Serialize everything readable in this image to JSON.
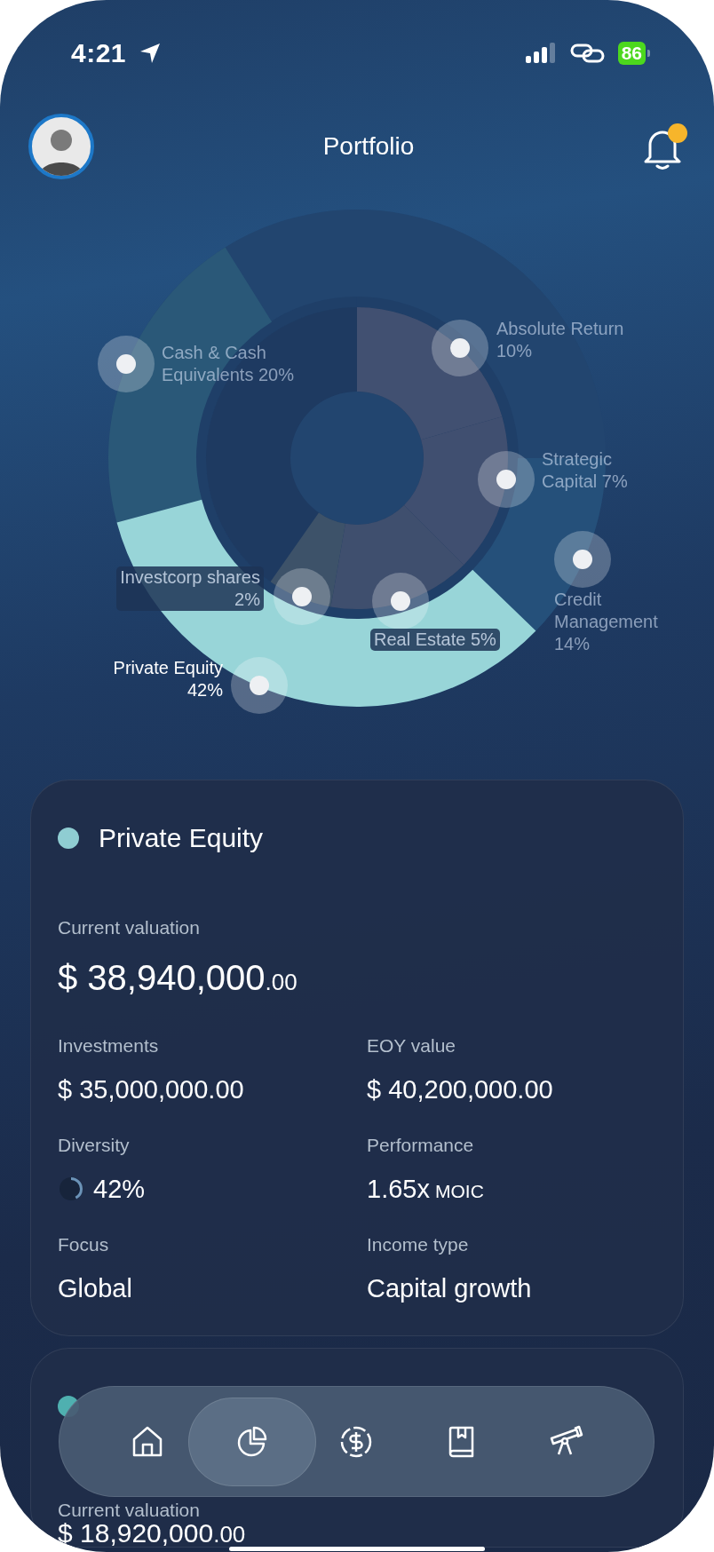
{
  "status_bar": {
    "time": "4:21",
    "battery": "86"
  },
  "header": {
    "title": "Portfolio",
    "notification_badge": true
  },
  "allocation": {
    "segments": [
      {
        "label": "Absolute Return\n10%",
        "kind": "inner",
        "selected": false
      },
      {
        "label": "Cash & Cash\nEquivalents 20%",
        "kind": "outer",
        "selected": false
      },
      {
        "label": "Strategic\nCapital 7%",
        "kind": "inner",
        "selected": false
      },
      {
        "label": "Investcorp shares\n2%",
        "kind": "inner",
        "selected": false
      },
      {
        "label": "Real Estate 5%",
        "kind": "inner",
        "selected": false
      },
      {
        "label": "Credit\nManagement\n14%",
        "kind": "outer",
        "selected": false
      },
      {
        "label": "Private Equity\n42%",
        "kind": "outer",
        "selected": true
      }
    ]
  },
  "cards": [
    {
      "color": "#8fcdd2",
      "title": "Private Equity",
      "valuation_label": "Current valuation",
      "valuation": "$ 38,940,000",
      "valuation_cents": ".00",
      "stats": [
        {
          "kind": "plain",
          "label": "Investments",
          "value": "$ 35,000,000.00"
        },
        {
          "kind": "plain",
          "label": "EOY value",
          "value": "$ 40,200,000.00"
        },
        {
          "kind": "ring",
          "label": "Diversity",
          "level": 0.42,
          "value": "42%"
        },
        {
          "kind": "unit",
          "label": "Performance",
          "value": "1.65x",
          "unit": "MOIC"
        },
        {
          "kind": "plain",
          "label": "Focus",
          "value": "Global"
        },
        {
          "kind": "plain",
          "label": "Income type",
          "value": "Capital growth"
        }
      ]
    },
    {
      "color": "#4fb0b0",
      "valuation_label": "Current valuation",
      "valuation": "$ 18,920,000",
      "valuation_cents": ".00"
    }
  ],
  "tab_bar": [
    {
      "kind": "home",
      "selected": false
    },
    {
      "kind": "pie",
      "selected": true
    },
    {
      "kind": "dollar",
      "selected": false
    },
    {
      "kind": "book",
      "selected": false
    },
    {
      "kind": "telescope",
      "selected": false
    }
  ]
}
